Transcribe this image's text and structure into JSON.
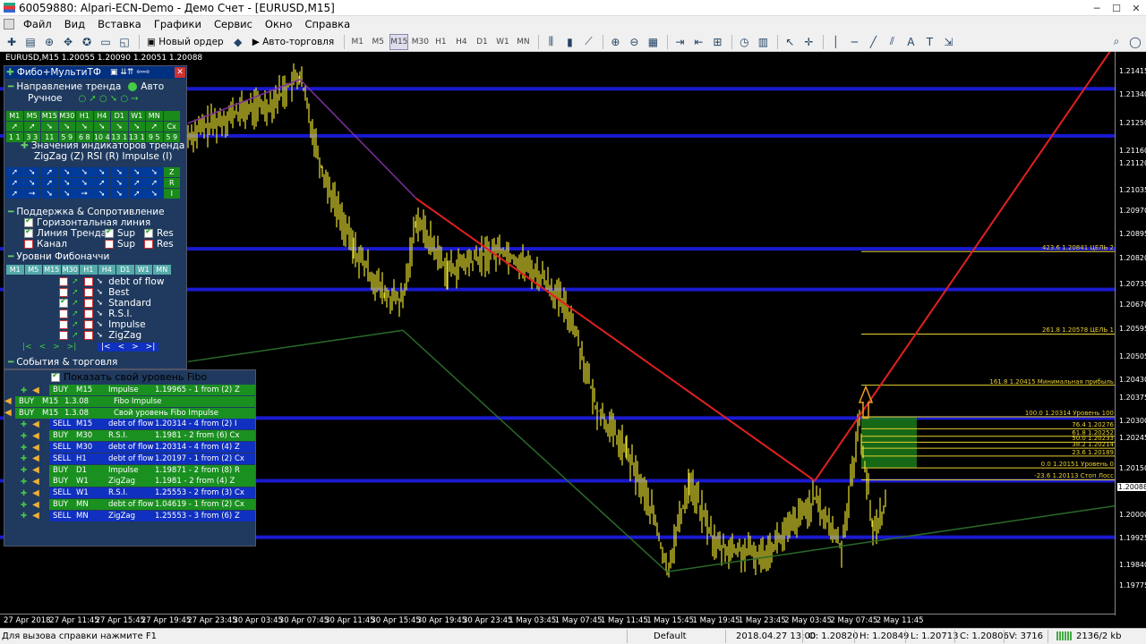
{
  "window": {
    "title": "60059880: Alpari-ECN-Demo - Демо Счет - [EURUSD,M15]"
  },
  "menu": [
    "Файл",
    "Вид",
    "Вставка",
    "Графики",
    "Сервис",
    "Окно",
    "Справка"
  ],
  "toolbar": {
    "new_order": "Новый ордер",
    "auto_trading": "Авто-торговля",
    "timeframes": [
      "M1",
      "M5",
      "M15",
      "M30",
      "H1",
      "H4",
      "D1",
      "W1",
      "MN"
    ],
    "selected_tf": "M15"
  },
  "chart": {
    "symbol_line": "EURUSD,M15  1.20055 1.20090 1.20051 1.20088",
    "price_labels": [
      "1.21415",
      "1.21340",
      "1.21250",
      "1.21160",
      "1.21120",
      "1.21035",
      "1.20970",
      "1.20895",
      "1.20820",
      "1.20735",
      "1.20670",
      "1.20595",
      "1.20505",
      "1.20430",
      "1.20375",
      "1.20300",
      "1.20245",
      "1.20150",
      "1.20088",
      "1.20000",
      "1.19925",
      "1.19840",
      "1.19775"
    ],
    "current_price": "1.20088",
    "time_labels": [
      "27 Apr 2018",
      "27 Apr 11:45",
      "27 Apr 15:45",
      "27 Apr 19:45",
      "27 Apr 23:45",
      "30 Apr 03:45",
      "30 Apr 07:45",
      "30 Apr 11:45",
      "30 Apr 15:45",
      "30 Apr 19:45",
      "30 Apr 23:45",
      "1 May 03:45",
      "1 May 07:45",
      "1 May 11:45",
      "1 May 15:45",
      "1 May 19:45",
      "1 May 23:45",
      "2 May 03:45",
      "2 May 07:45",
      "2 May 11:45"
    ],
    "fibo_labels": [
      "423.6  1.20841 ЦЕЛЬ 2",
      "261.8  1.20578 ЦЕЛЬ 1",
      "161.8  1.20415 Минимальная прибыль",
      "100.0  1.20314 Уровень 100",
      "76.4  1.20276",
      "61.8  1.20252",
      "50.0  1.20233",
      "38.2  1.20214",
      "23.6  1.20189",
      "0.0  1.20151 Уровень 0",
      "-23.6  1.20113 Стоп Лосс"
    ]
  },
  "panel": {
    "title": "Фибо+МультиТФ",
    "trend_direction": "Направление тренда",
    "auto": "Авто",
    "manual": "Ручное",
    "tf_headers": [
      "M1",
      "M5",
      "M15",
      "M30",
      "H1",
      "H4",
      "D1",
      "W1",
      "MN"
    ],
    "tf_values": [
      "1 1",
      "3 3",
      "11",
      "5 9",
      "6 8",
      "10 4",
      "13 1",
      "13 1",
      "9 5",
      "5 9"
    ],
    "close_label": "Cx",
    "indicator_values": "Значения индикаторов тренда",
    "indicators": "ZigZag (Z)  RSI (R)  Impulse (I)",
    "ind_letters": [
      "Z",
      "R",
      "I"
    ],
    "support_resistance": "Поддержка & Сопротивление",
    "horizontal_line": "Горизонтальная линия",
    "trend_line": "Линия Тренда",
    "channel": "Канал",
    "sup": "Sup",
    "res": "Res",
    "fibo_levels": "Уровни Фибоначчи",
    "fibo_items": [
      "debt of flow",
      "Best",
      "Standard",
      "R.S.I.",
      "Impulse",
      "ZigZag"
    ],
    "nav": [
      "|<",
      "<",
      ">",
      ">|"
    ],
    "events": "События & торговля"
  },
  "events": {
    "show_label": "Показать свой уровень Fibo",
    "rows": [
      {
        "type": "BUY",
        "tf": "M15",
        "text": "Impulse",
        "detail": "1.19965 - 1 from (2) Z"
      },
      {
        "type": "BUY",
        "tf": "M15",
        "text": "1.3.08",
        "detail": "Fibo Impulse"
      },
      {
        "type": "BUY",
        "tf": "M15",
        "text": "1.3.08",
        "detail": "Свой уровень Fibo Impulse"
      },
      {
        "type": "SELL",
        "tf": "M15",
        "text": "debt of flow",
        "detail": "1.20314 - 4 from (2) I"
      },
      {
        "type": "BUY",
        "tf": "M30",
        "text": "R.S.I.",
        "detail": "1.1981 - 2 from (6) Cx"
      },
      {
        "type": "SELL",
        "tf": "M30",
        "text": "debt of flow",
        "detail": "1.20314 - 4 from (4) Z"
      },
      {
        "type": "SELL",
        "tf": "H1",
        "text": "debt of flow",
        "detail": "1.20197 - 1 from (2) Cx"
      },
      {
        "type": "BUY",
        "tf": "D1",
        "text": "Impulse",
        "detail": "1.19871 - 2 from (8) R"
      },
      {
        "type": "BUY",
        "tf": "W1",
        "text": "ZigZag",
        "detail": "1.1981 - 2 from (4) Z"
      },
      {
        "type": "SELL",
        "tf": "W1",
        "text": "R.S.I.",
        "detail": "1.25553 - 2 from (3) Cx"
      },
      {
        "type": "BUY",
        "tf": "MN",
        "text": "debt of flow",
        "detail": "1.04619 - 1 from (2) Cx"
      },
      {
        "type": "SELL",
        "tf": "MN",
        "text": "ZigZag",
        "detail": "1.25553 - 3 from (6) Z"
      }
    ]
  },
  "status": {
    "help": "Для вызова справки нажмите F1",
    "profile": "Default",
    "datetime": "2018.04.27 13:00",
    "open": "O: 1.20820",
    "high": "H: 1.20849",
    "low": "L: 1.20713",
    "close": "C: 1.20806",
    "volume": "V: 3716",
    "traffic": "2136/2 kb"
  }
}
